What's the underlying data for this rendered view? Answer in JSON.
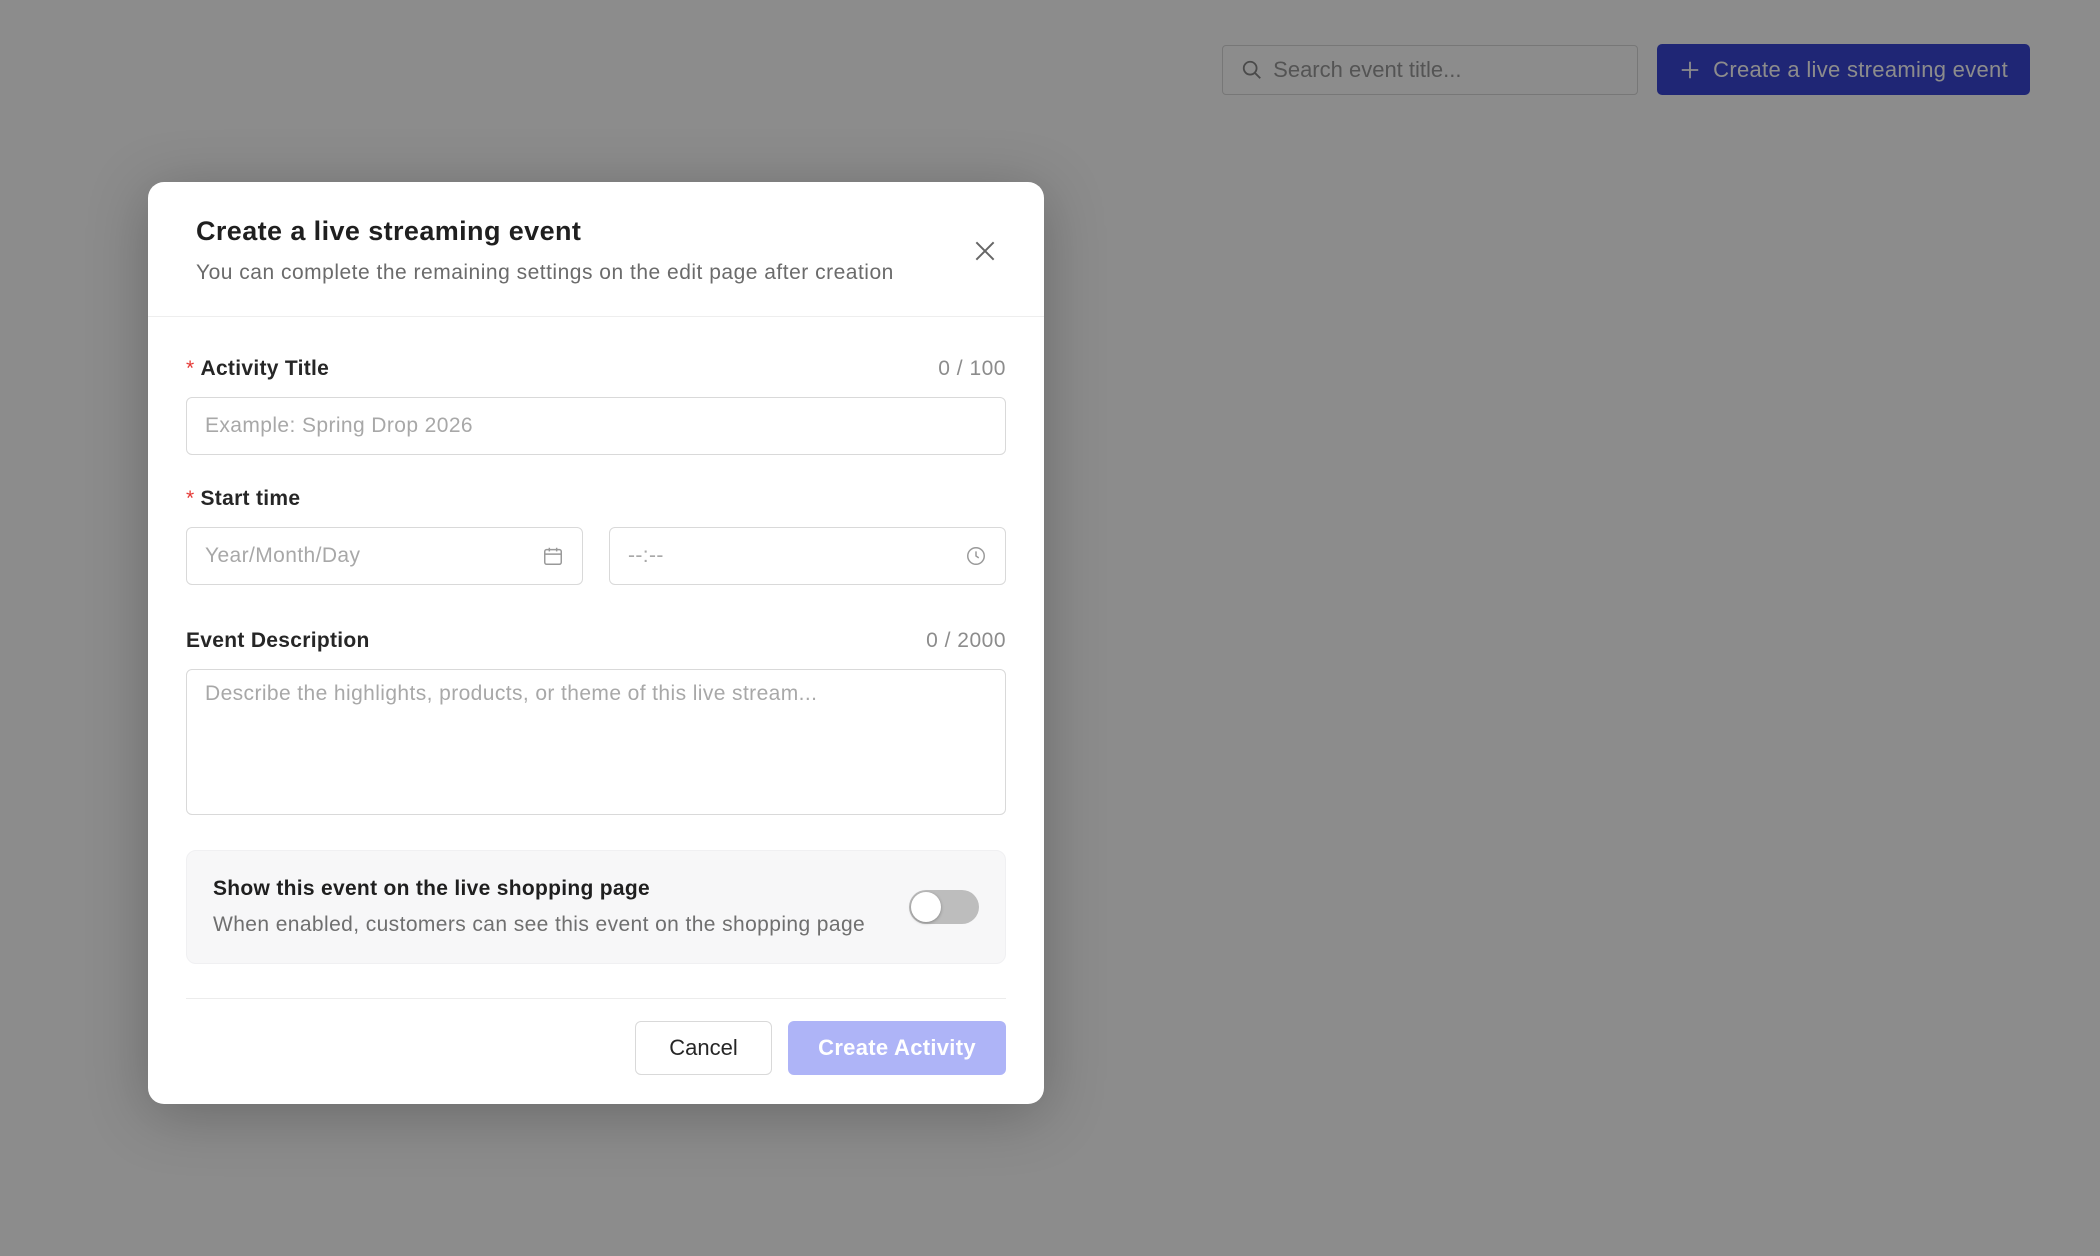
{
  "toolbar": {
    "search_placeholder": "Search event title...",
    "create_label": "Create a live streaming event"
  },
  "modal": {
    "title": "Create a live streaming event",
    "subtitle": "You can complete the remaining settings on the edit page after creation",
    "activity_title": {
      "required_mark": "*",
      "label": "Activity Title",
      "counter": "0 / 100",
      "placeholder": "Example: Spring Drop 2026",
      "value": ""
    },
    "start_time": {
      "required_mark": "*",
      "label": "Start time",
      "date_placeholder": "Year/Month/Day",
      "time_placeholder": "--:--"
    },
    "description": {
      "label": "Event Description",
      "counter": "0 / 2000",
      "placeholder": "Describe the highlights, products, or theme of this live stream..."
    },
    "visibility": {
      "title": "Show this event on the live shopping page",
      "description": "When enabled, customers can see this event on the shopping page",
      "enabled": false
    },
    "buttons": {
      "cancel": "Cancel",
      "create": "Create Activity"
    }
  },
  "colors": {
    "primary": "#3a45d6",
    "primary_disabled": "#aeb4f7",
    "required": "#e53935"
  }
}
